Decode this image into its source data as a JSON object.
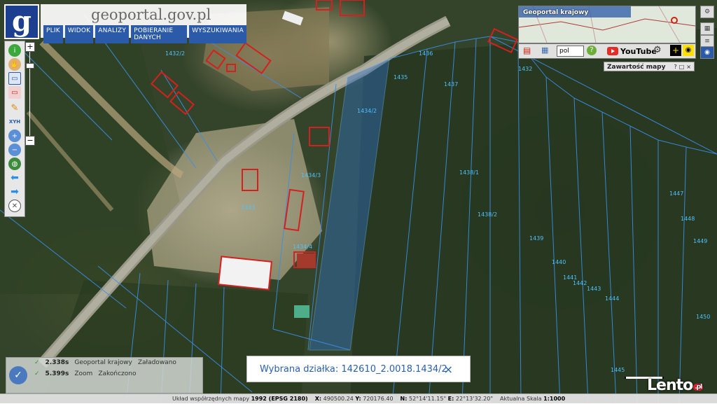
{
  "header": {
    "logo_letter": "g",
    "site_title": "geoportal.gov.pl",
    "menu": [
      "PLIK",
      "WIDOK",
      "ANALIZY",
      "POBIERANIE DANYCH",
      "WYSZUKIWANIA"
    ]
  },
  "toolbar": {
    "tools": [
      "info-icon",
      "pan-hand-icon",
      "select-box-icon",
      "select-remove-icon",
      "pencil-icon",
      "xyh-icon",
      "zoom-in-icon",
      "zoom-out-icon",
      "globe-icon",
      "back-arrow-icon",
      "forward-arrow-icon",
      "compass-icon"
    ],
    "xyh_label": "XYH",
    "zoom_in": "+",
    "zoom_out": "−"
  },
  "overview": {
    "title": "Geoportal krajowy"
  },
  "overview_tools": {
    "language": "pol",
    "youtube_label": "YouTube"
  },
  "content_panel": {
    "title": "Zawartość mapy",
    "buttons": [
      "?",
      "□",
      "×"
    ]
  },
  "parcel_labels": [
    {
      "text": "1436"
    },
    {
      "text": "1435"
    },
    {
      "text": "1437"
    },
    {
      "text": "1434/2"
    },
    {
      "text": "1434/3"
    },
    {
      "text": "1433"
    },
    {
      "text": "1434/4"
    },
    {
      "text": "1438/1"
    },
    {
      "text": "1438/2"
    },
    {
      "text": "1439"
    },
    {
      "text": "1440"
    },
    {
      "text": "1441"
    },
    {
      "text": "1442"
    },
    {
      "text": "1443"
    },
    {
      "text": "1444"
    },
    {
      "text": "1445"
    },
    {
      "text": "1447"
    },
    {
      "text": "1448"
    },
    {
      "text": "1449"
    },
    {
      "text": "1450"
    },
    {
      "text": "1432"
    },
    {
      "text": "1432/2"
    }
  ],
  "log": {
    "rows": [
      {
        "time": "2.338s",
        "source": "Geoportal krajowy",
        "status": "Załadowano"
      },
      {
        "time": "5.399s",
        "source": "Zoom",
        "status": "Zakończono"
      }
    ]
  },
  "selection_popup": {
    "label": "Wybrana działka: 142610_2.0018.1434/2",
    "close": "×"
  },
  "statusbar": {
    "system_label": "Układ współrzędnych mapy",
    "system_value": "1992 (EPSG 2180)",
    "x_label": "X:",
    "x_value": "490500.24",
    "y_label": "Y:",
    "y_value": "720176.40",
    "n_label": "N:",
    "n_value": "52°14'11.15\"",
    "e_label": "E:",
    "e_value": "22°13'32.20\"",
    "scale_label": "Aktualna Skala",
    "scale_value": "1:1000"
  },
  "watermark": {
    "text": "Lento",
    "suffix": ".pl"
  },
  "colors": {
    "parcel_line": "#3a8fe8",
    "building_outline": "#d4201e",
    "selected_parcel": "#2f6fc0",
    "menu_bg": "#2b5aa8"
  }
}
